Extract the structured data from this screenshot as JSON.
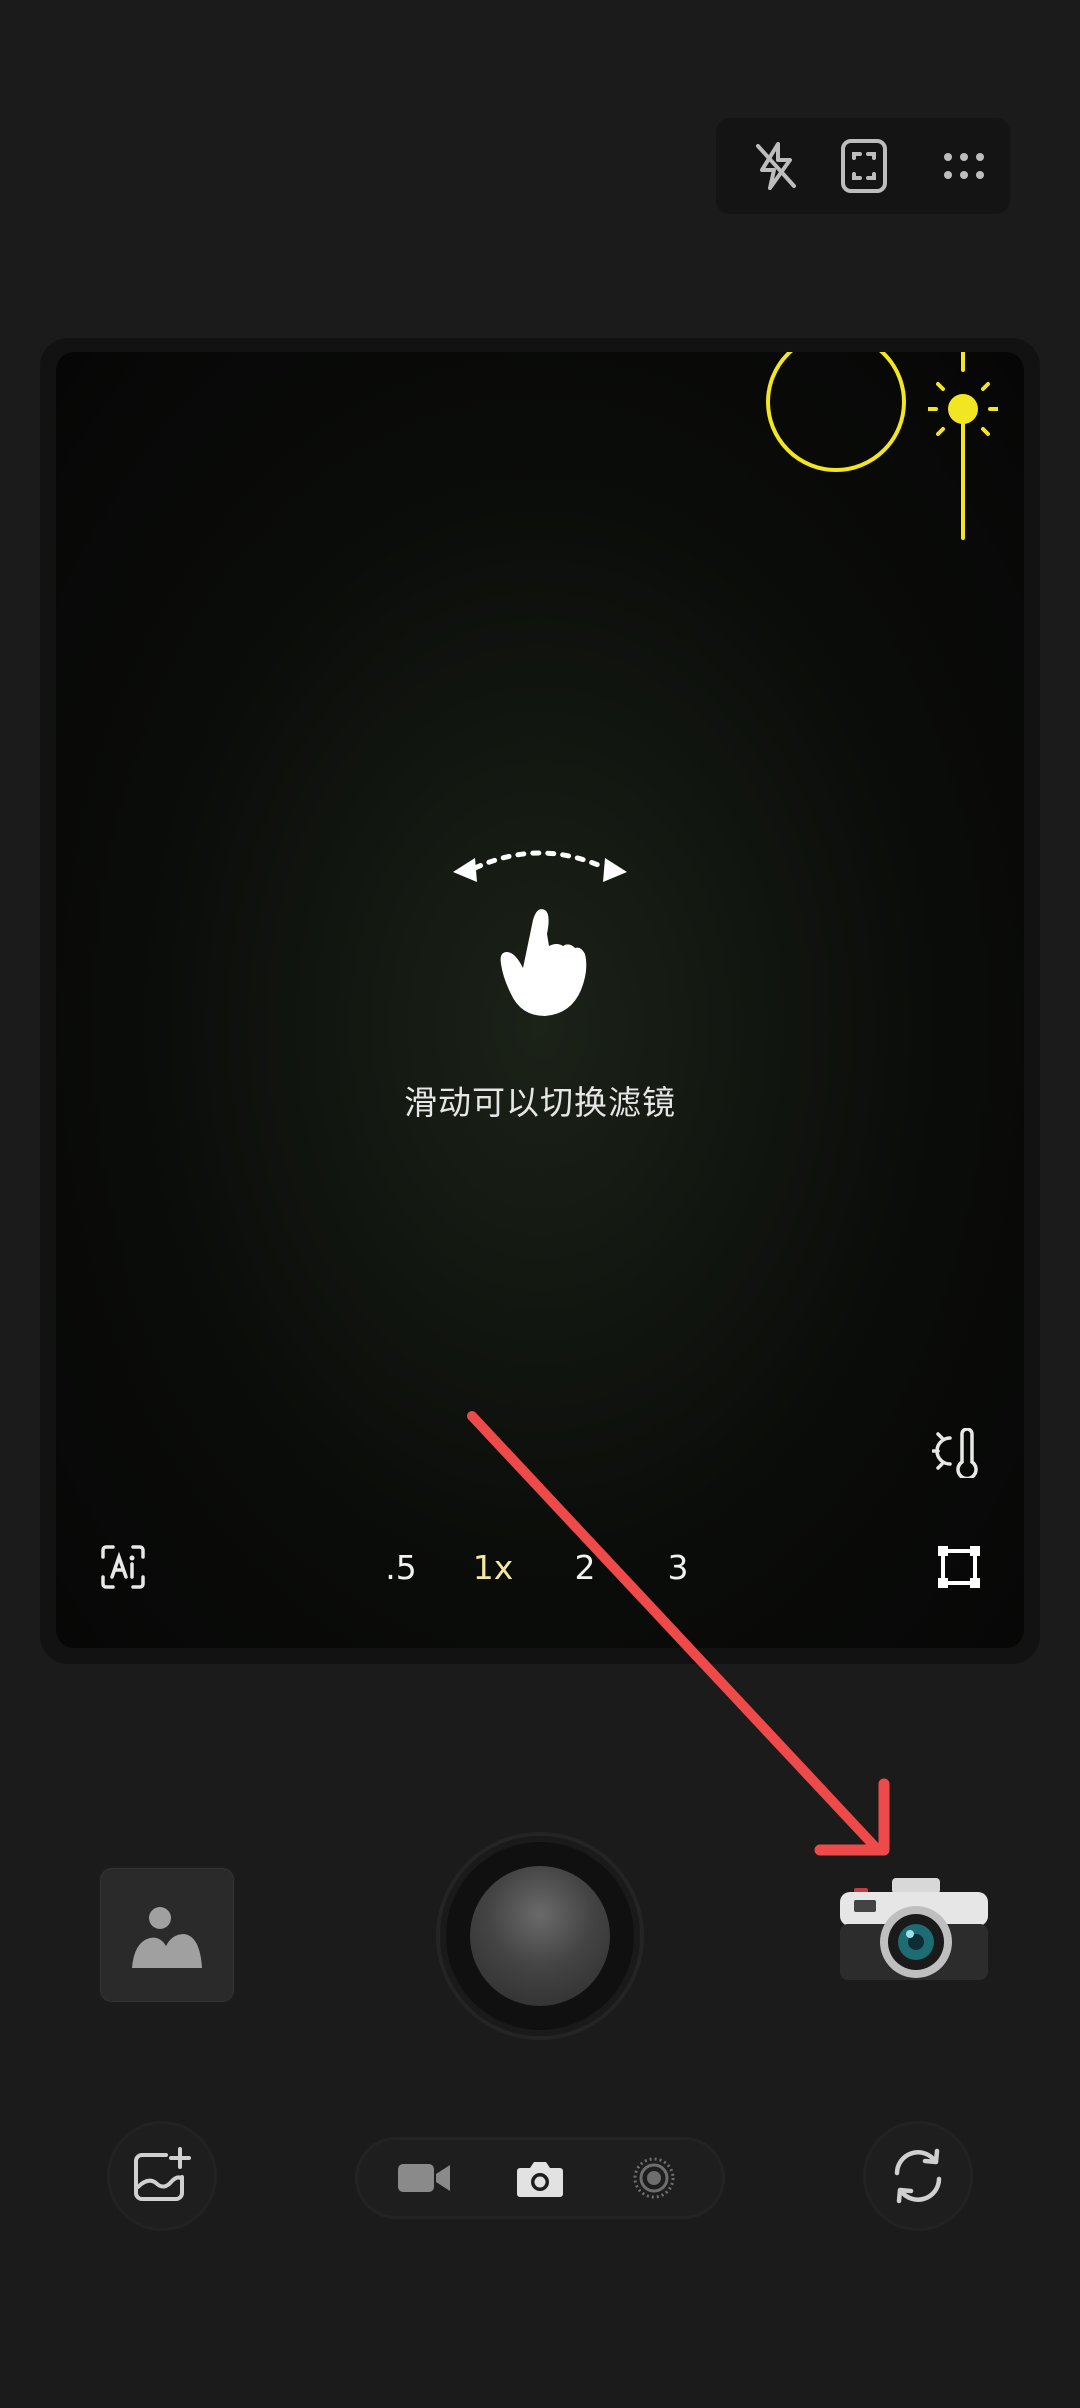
{
  "viewfinder": {
    "hint_text": "滑动可以切换滤镜"
  },
  "zoom": {
    "options": [
      ".5",
      "1x",
      "2",
      "3"
    ],
    "selected": "1x",
    "selected_color": "#f5e7a0"
  },
  "colors": {
    "focus_ring": "#f2e522",
    "exposure": "#f2e522",
    "annotation_arrow": "#ef4a4a"
  },
  "icons": {
    "flash": "flash-off-icon",
    "frame": "frame-icon",
    "more": "more-dots-icon",
    "ai": "ai-scan-icon",
    "white_balance": "white-balance-icon",
    "crop": "crop-square-icon",
    "gallery": "gallery-icon",
    "camera_style": "retro-camera-icon",
    "add_image": "add-image-icon",
    "video_mode": "video-icon",
    "photo_mode": "camera-icon",
    "live_mode": "live-icon",
    "switch_camera": "switch-camera-icon"
  }
}
